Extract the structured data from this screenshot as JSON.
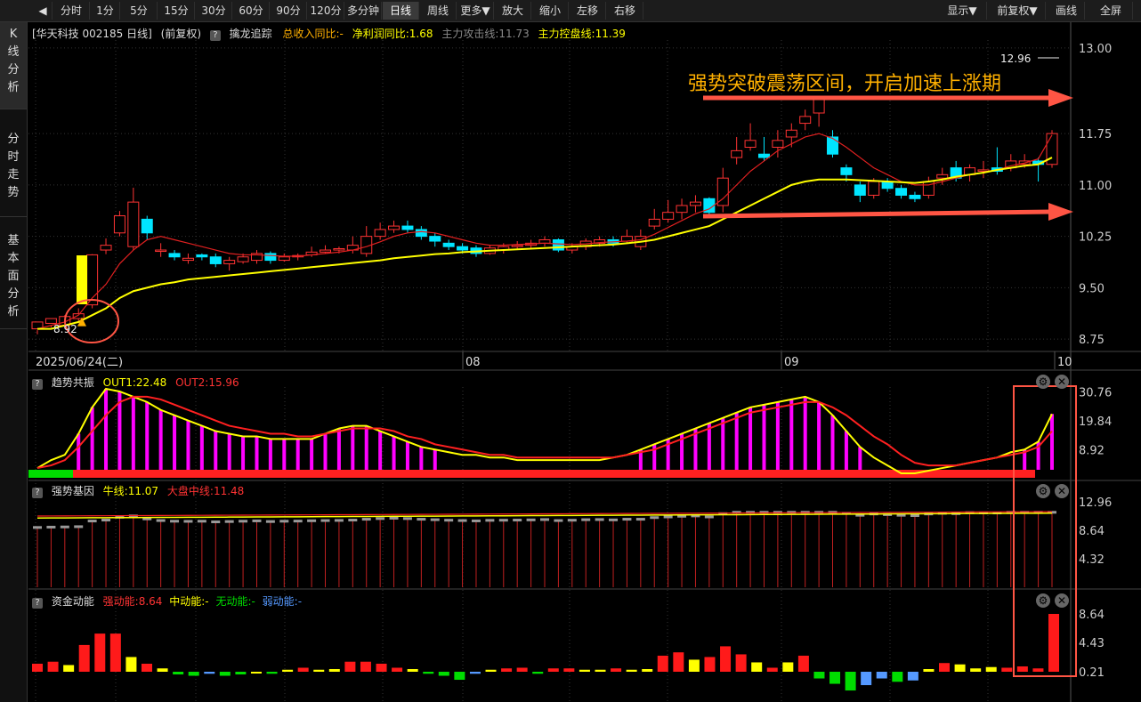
{
  "toolbar": {
    "items": [
      "分时",
      "1分",
      "5分",
      "15分",
      "30分",
      "60分",
      "90分",
      "120分",
      "多分钟",
      "日线",
      "周线",
      "更多▼",
      "放大",
      "缩小",
      "左移",
      "右移"
    ],
    "right_items": [
      "显示▼",
      "前复权▼",
      "画线",
      "全屏"
    ],
    "active": "日线"
  },
  "sidebar": {
    "items": [
      "K\n线\n分\n析",
      "分\n时\n走\n势",
      "基\n本\n面\n分\n析"
    ]
  },
  "main": {
    "title": "[华天科技 002185 日线]",
    "adjust": "(前复权)",
    "indicator_name": "擒龙追踪",
    "ind1": "总收入同比:-",
    "ind2": "净利润同比:1.68",
    "ind3": "主力攻击线:11.73",
    "ind4": "主力控盘线:11.39",
    "annotation": "强势突破震荡区间，开启加速上涨期",
    "high_label": "12.96",
    "low_label": "8.92",
    "date_label": "2025/06/24(二)",
    "x_ticks": [
      "08",
      "09",
      "10"
    ],
    "y_ticks": [
      "13.00",
      "11.75",
      "11.00",
      "10.25",
      "9.50",
      "8.75"
    ]
  },
  "panel1": {
    "name": "趋势共振",
    "out1": "OUT1:22.48",
    "out2": "OUT2:15.96",
    "y_ticks": [
      "30.76",
      "19.84",
      "8.92"
    ]
  },
  "panel2": {
    "name": "强势基因",
    "l1": "牛线:11.07",
    "l2": "大盘中线:11.48",
    "y_ticks": [
      "12.96",
      "8.64",
      "4.32"
    ]
  },
  "panel3": {
    "name": "资金动能",
    "s1": "强动能:8.64",
    "s2": "中动能:-",
    "s3": "无动能:-",
    "s4": "弱动能:-",
    "y_ticks": [
      "8.64",
      "4.43",
      "0.21"
    ]
  },
  "colors": {
    "up": "#ff3333",
    "down": "#00e5ff",
    "yellow": "#ffff00",
    "magenta": "#ff00ff",
    "orange": "#ffb000",
    "green": "#00dd00",
    "blue": "#5599ff",
    "box": "#ff5544"
  },
  "chart_data": {
    "type": "candlestick",
    "candles": [
      [
        8.9,
        9.0,
        8.88,
        8.82
      ],
      [
        8.98,
        9.05,
        8.95,
        8.92
      ],
      [
        8.95,
        9.08,
        9.1,
        8.92
      ],
      [
        9.05,
        9.12,
        9.2,
        9.0
      ],
      [
        9.25,
        9.98,
        9.99,
        9.2
      ],
      [
        10.05,
        10.12,
        10.22,
        9.99
      ],
      [
        10.3,
        10.55,
        10.62,
        10.25
      ],
      [
        10.1,
        10.75,
        10.96,
        10.05
      ],
      [
        10.5,
        10.3,
        10.55,
        10.2
      ],
      [
        10.05,
        10.05,
        10.15,
        9.95
      ],
      [
        10.0,
        9.95,
        10.05,
        9.9
      ],
      [
        9.9,
        9.93,
        10.0,
        9.85
      ],
      [
        9.98,
        9.95,
        10.0,
        9.9
      ],
      [
        9.95,
        9.85,
        10.0,
        9.8
      ],
      [
        9.85,
        9.9,
        9.95,
        9.75
      ],
      [
        9.88,
        9.95,
        10.0,
        9.85
      ],
      [
        9.9,
        10.0,
        10.05,
        9.85
      ],
      [
        10.0,
        9.9,
        10.03,
        9.85
      ],
      [
        9.9,
        9.95,
        10.0,
        9.88
      ],
      [
        9.95,
        9.97,
        10.0,
        9.9
      ],
      [
        9.98,
        10.02,
        10.1,
        9.95
      ],
      [
        10.02,
        10.05,
        10.12,
        10.0
      ],
      [
        10.05,
        10.07,
        10.1,
        10.0
      ],
      [
        10.05,
        10.12,
        10.25,
        10.0
      ],
      [
        10.0,
        10.25,
        10.4,
        9.95
      ],
      [
        10.25,
        10.35,
        10.45,
        10.2
      ],
      [
        10.35,
        10.4,
        10.48,
        10.3
      ],
      [
        10.4,
        10.35,
        10.48,
        10.3
      ],
      [
        10.35,
        10.25,
        10.4,
        10.2
      ],
      [
        10.25,
        10.18,
        10.3,
        10.1
      ],
      [
        10.15,
        10.1,
        10.2,
        10.05
      ],
      [
        10.1,
        10.05,
        10.15,
        10.0
      ],
      [
        10.08,
        10.0,
        10.12,
        9.95
      ],
      [
        10.0,
        10.08,
        10.12,
        9.98
      ],
      [
        10.05,
        10.1,
        10.15,
        10.0
      ],
      [
        10.1,
        10.12,
        10.18,
        10.05
      ],
      [
        10.12,
        10.15,
        10.2,
        10.08
      ],
      [
        10.15,
        10.2,
        10.25,
        10.1
      ],
      [
        10.2,
        10.05,
        10.22,
        10.02
      ],
      [
        10.05,
        10.1,
        10.15,
        10.0
      ],
      [
        10.1,
        10.18,
        10.22,
        10.05
      ],
      [
        10.15,
        10.2,
        10.25,
        10.1
      ],
      [
        10.2,
        10.15,
        10.25,
        10.1
      ],
      [
        10.18,
        10.25,
        10.35,
        10.15
      ],
      [
        10.1,
        10.25,
        10.35,
        10.05
      ],
      [
        10.4,
        10.5,
        10.65,
        10.35
      ],
      [
        10.5,
        10.6,
        10.78,
        10.45
      ],
      [
        10.6,
        10.7,
        10.8,
        10.5
      ],
      [
        10.7,
        10.75,
        10.85,
        10.6
      ],
      [
        10.8,
        10.6,
        10.82,
        10.55
      ],
      [
        10.7,
        11.1,
        11.25,
        10.6
      ],
      [
        11.4,
        11.5,
        11.7,
        11.3
      ],
      [
        11.55,
        11.65,
        11.9,
        11.5
      ],
      [
        11.45,
        11.4,
        11.7,
        11.35
      ],
      [
        11.55,
        11.65,
        11.8,
        11.4
      ],
      [
        11.7,
        11.8,
        11.9,
        11.55
      ],
      [
        11.9,
        12.0,
        12.1,
        11.8
      ],
      [
        12.05,
        12.25,
        12.3,
        11.85
      ],
      [
        11.7,
        11.45,
        11.8,
        11.4
      ],
      [
        11.25,
        11.15,
        11.3,
        11.05
      ],
      [
        11.0,
        10.85,
        11.05,
        10.75
      ],
      [
        10.85,
        11.05,
        11.1,
        10.8
      ],
      [
        11.05,
        10.95,
        11.1,
        10.9
      ],
      [
        10.95,
        10.85,
        11.0,
        10.8
      ],
      [
        10.85,
        10.8,
        10.9,
        10.75
      ],
      [
        10.85,
        11.05,
        11.12,
        10.8
      ],
      [
        11.1,
        11.15,
        11.25,
        11.0
      ],
      [
        11.25,
        11.1,
        11.35,
        11.05
      ],
      [
        11.15,
        11.25,
        11.3,
        11.05
      ],
      [
        11.2,
        11.22,
        11.35,
        11.1
      ],
      [
        11.25,
        11.2,
        11.55,
        11.15
      ],
      [
        11.25,
        11.35,
        11.45,
        11.2
      ],
      [
        11.3,
        11.35,
        11.45,
        11.25
      ],
      [
        11.35,
        11.3,
        11.4,
        11.05
      ],
      [
        11.3,
        11.75,
        11.8,
        11.25
      ]
    ],
    "ma_yellow": [
      8.9,
      8.9,
      8.95,
      9.0,
      9.1,
      9.2,
      9.35,
      9.45,
      9.5,
      9.55,
      9.58,
      9.62,
      9.64,
      9.66,
      9.68,
      9.7,
      9.72,
      9.74,
      9.76,
      9.78,
      9.8,
      9.82,
      9.84,
      9.86,
      9.88,
      9.9,
      9.93,
      9.95,
      9.97,
      9.99,
      10.0,
      10.02,
      10.03,
      10.04,
      10.05,
      10.06,
      10.07,
      10.08,
      10.09,
      10.1,
      10.11,
      10.12,
      10.13,
      10.15,
      10.17,
      10.2,
      10.25,
      10.3,
      10.35,
      10.4,
      10.5,
      10.6,
      10.7,
      10.8,
      10.9,
      11.0,
      11.05,
      11.08,
      11.08,
      11.08,
      11.07,
      11.06,
      11.05,
      11.04,
      11.03,
      11.05,
      11.08,
      11.12,
      11.15,
      11.18,
      11.22,
      11.25,
      11.28,
      11.3,
      11.4
    ],
    "ma_red": [
      8.9,
      8.95,
      9.0,
      9.1,
      9.35,
      9.55,
      9.85,
      10.05,
      10.2,
      10.25,
      10.2,
      10.15,
      10.1,
      10.05,
      10.0,
      9.98,
      9.98,
      9.97,
      9.96,
      9.96,
      9.98,
      10.0,
      10.02,
      10.05,
      10.1,
      10.17,
      10.25,
      10.3,
      10.32,
      10.3,
      10.25,
      10.2,
      10.15,
      10.12,
      10.12,
      10.13,
      10.14,
      10.15,
      10.14,
      10.13,
      10.14,
      10.16,
      10.17,
      10.18,
      10.2,
      10.28,
      10.38,
      10.48,
      10.58,
      10.65,
      10.8,
      11.0,
      11.2,
      11.35,
      11.5,
      11.6,
      11.7,
      11.75,
      11.68,
      11.55,
      11.4,
      11.25,
      11.15,
      11.05,
      11.0,
      11.0,
      11.05,
      11.1,
      11.15,
      11.18,
      11.22,
      11.28,
      11.32,
      11.38,
      11.73
    ],
    "panel1_out1": [
      2,
      5,
      7,
      15,
      25,
      32,
      31,
      29,
      27,
      24,
      22,
      20,
      18,
      16,
      15,
      14,
      14,
      13,
      13,
      13,
      13,
      15,
      17,
      18,
      18,
      16,
      14,
      12,
      10,
      9,
      8,
      7,
      7,
      6,
      6,
      5,
      5,
      5,
      5,
      5,
      5,
      5,
      6,
      7,
      9,
      11,
      13,
      15,
      17,
      19,
      21,
      23,
      25,
      26,
      27,
      28,
      29,
      27,
      22,
      16,
      10,
      6,
      3,
      0,
      0,
      1,
      2,
      3,
      4,
      5,
      6,
      8,
      9,
      12,
      22.48
    ],
    "panel1_out2": [
      2,
      3,
      5,
      10,
      16,
      22,
      27,
      29,
      29,
      28,
      26,
      24,
      22,
      20,
      18,
      17,
      16,
      15,
      15,
      14,
      14,
      15,
      16,
      17,
      17,
      17,
      16,
      14,
      13,
      11,
      10,
      9,
      8,
      7,
      7,
      6,
      6,
      6,
      6,
      6,
      6,
      6,
      6,
      7,
      8,
      9,
      11,
      13,
      15,
      17,
      19,
      21,
      23,
      24,
      25,
      26,
      27,
      27,
      25,
      22,
      18,
      14,
      11,
      7,
      4,
      3,
      3,
      3,
      4,
      5,
      6,
      7,
      8,
      10,
      15.96
    ],
    "panel3_vals": [
      [
        1.2,
        "red"
      ],
      [
        1.5,
        "red"
      ],
      [
        1,
        "yellow"
      ],
      [
        4,
        "red"
      ],
      [
        5.7,
        "red"
      ],
      [
        5.7,
        "red"
      ],
      [
        2.2,
        "yellow"
      ],
      [
        1.2,
        "red"
      ],
      [
        0.5,
        "yellow"
      ],
      [
        -0.4,
        "green"
      ],
      [
        -0.6,
        "green"
      ],
      [
        -0.3,
        "blue"
      ],
      [
        -0.6,
        "green"
      ],
      [
        -0.4,
        "green"
      ],
      [
        -0.2,
        "yellow"
      ],
      [
        -0.3,
        "green"
      ],
      [
        0.3,
        "yellow"
      ],
      [
        0.6,
        "red"
      ],
      [
        0.3,
        "yellow"
      ],
      [
        0.4,
        "yellow"
      ],
      [
        1.5,
        "red"
      ],
      [
        1.5,
        "red"
      ],
      [
        1.2,
        "red"
      ],
      [
        0.6,
        "red"
      ],
      [
        0.4,
        "yellow"
      ],
      [
        -0.3,
        "green"
      ],
      [
        -0.6,
        "green"
      ],
      [
        -1.2,
        "green"
      ],
      [
        -0.3,
        "blue"
      ],
      [
        0.3,
        "yellow"
      ],
      [
        0.5,
        "red"
      ],
      [
        0.6,
        "red"
      ],
      [
        -0.3,
        "green"
      ],
      [
        0.5,
        "red"
      ],
      [
        0.5,
        "red"
      ],
      [
        0.3,
        "yellow"
      ],
      [
        0.3,
        "yellow"
      ],
      [
        0.5,
        "red"
      ],
      [
        0.3,
        "yellow"
      ],
      [
        0.4,
        "yellow"
      ],
      [
        2.4,
        "red"
      ],
      [
        2.9,
        "red"
      ],
      [
        1.8,
        "yellow"
      ],
      [
        2.2,
        "red"
      ],
      [
        3.8,
        "red"
      ],
      [
        2.6,
        "red"
      ],
      [
        1.4,
        "yellow"
      ],
      [
        0.6,
        "red"
      ],
      [
        1.4,
        "yellow"
      ],
      [
        2.4,
        "red"
      ],
      [
        -1.0,
        "green"
      ],
      [
        -1.8,
        "green"
      ],
      [
        -2.8,
        "green"
      ],
      [
        -2.0,
        "blue"
      ],
      [
        -1.0,
        "blue"
      ],
      [
        -1.5,
        "green"
      ],
      [
        -1.3,
        "blue"
      ],
      [
        0.4,
        "yellow"
      ],
      [
        1.3,
        "red"
      ],
      [
        1.1,
        "yellow"
      ],
      [
        0.5,
        "yellow"
      ],
      [
        0.7,
        "yellow"
      ],
      [
        0.6,
        "red"
      ],
      [
        0.8,
        "red"
      ],
      [
        0.5,
        "red"
      ],
      [
        8.64,
        "red"
      ]
    ]
  }
}
